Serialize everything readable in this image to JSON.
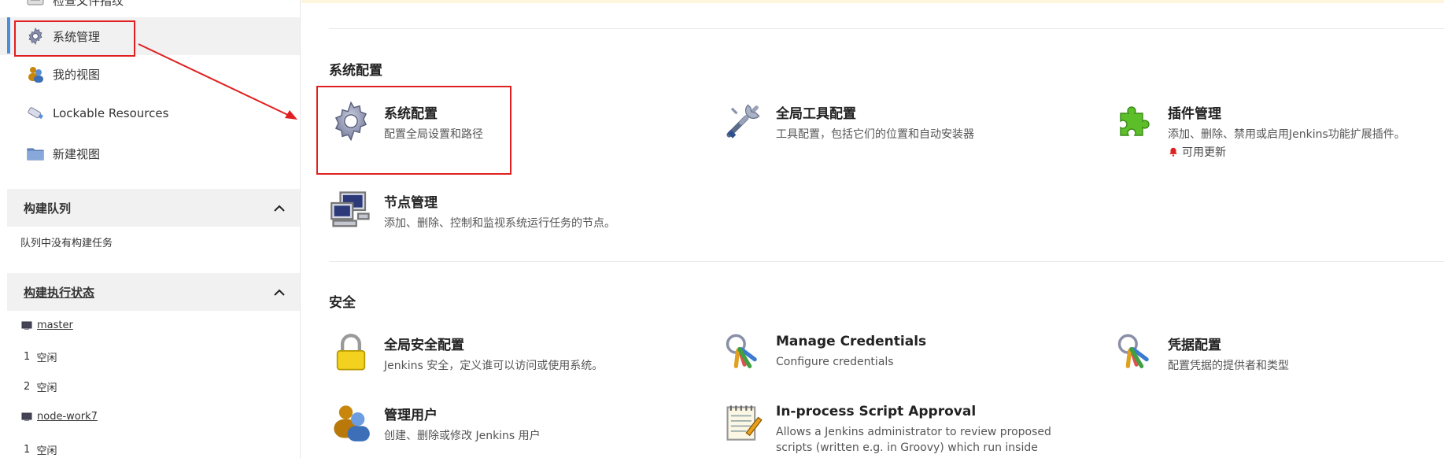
{
  "sidebar": {
    "items": [
      {
        "label": "检查文件指纹",
        "icon": "fingerprint-icon"
      },
      {
        "label": "系统管理",
        "icon": "gear-icon"
      },
      {
        "label": "我的视图",
        "icon": "users-icon"
      },
      {
        "label": "Lockable Resources",
        "icon": "usb-drive-icon"
      },
      {
        "label": "新建视图",
        "icon": "folder-icon"
      }
    ],
    "build_queue": {
      "title": "构建队列",
      "empty_text": "队列中没有构建任务"
    },
    "executors": {
      "title": "构建执行状态",
      "nodes": [
        {
          "name": "master",
          "slots": [
            {
              "num": "1",
              "status": "空闲"
            },
            {
              "num": "2",
              "status": "空闲"
            }
          ]
        },
        {
          "name": "node-work7",
          "slots": [
            {
              "num": "1",
              "status": "空闲"
            }
          ]
        }
      ]
    }
  },
  "main": {
    "sections": [
      {
        "title": "系统配置",
        "items": [
          {
            "title": "系统配置",
            "desc": "配置全局设置和路径",
            "icon": "gear-icon"
          },
          {
            "title": "全局工具配置",
            "desc": "工具配置，包括它们的位置和自动安装器",
            "icon": "tools-icon"
          },
          {
            "title": "插件管理",
            "desc": "添加、删除、禁用或启用Jenkins功能扩展插件。",
            "note": "可用更新",
            "icon": "puzzle-icon"
          },
          {
            "title": "节点管理",
            "desc": "添加、删除、控制和监视系统运行任务的节点。",
            "icon": "computer-icon"
          }
        ]
      },
      {
        "title": "安全",
        "items": [
          {
            "title": "全局安全配置",
            "desc": "Jenkins 安全，定义谁可以访问或使用系统。",
            "icon": "lock-icon"
          },
          {
            "title": "Manage Credentials",
            "desc": "Configure credentials",
            "icon": "keys-icon"
          },
          {
            "title": "凭据配置",
            "desc": "配置凭据的提供者和类型",
            "icon": "keys-icon"
          },
          {
            "title": "管理用户",
            "desc": "创建、删除或修改 Jenkins 用户",
            "icon": "users-icon"
          },
          {
            "title": "In-process Script Approval",
            "desc": "Allows a Jenkins administrator to review proposed scripts (written e.g. in Groovy) which run inside the",
            "icon": "notepad-icon"
          }
        ]
      }
    ]
  },
  "colors": {
    "annotation": "#e02020",
    "active_bar": "#4a90d9",
    "bell": "#e02020"
  }
}
